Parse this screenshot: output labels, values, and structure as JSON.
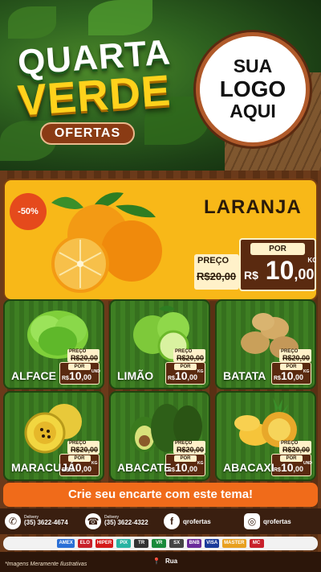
{
  "header": {
    "title_line1": "QUARTA",
    "title_line2": "VERDE",
    "subtitle_badge": "OFERTAS",
    "logo_placeholder": [
      "SUA",
      "LOGO",
      "AQUI"
    ]
  },
  "featured": {
    "name": "LARANJA",
    "discount_badge": "-50%",
    "old_price_label": "PREÇO",
    "old_price": "R$20,00",
    "new_price_label": "POR",
    "currency": "R$",
    "price_int": "10",
    "price_cents": ",00",
    "unit": "KG"
  },
  "products": [
    {
      "name": "ALFACE",
      "old_label": "PREÇO",
      "old_price": "R$20,00",
      "new_label": "POR",
      "currency": "R$",
      "price_int": "10",
      "price_cents": ",00",
      "unit": "UND"
    },
    {
      "name": "LIMÃO",
      "old_label": "PREÇO",
      "old_price": "R$20,00",
      "new_label": "POR",
      "currency": "R$",
      "price_int": "10",
      "price_cents": ",00",
      "unit": "KG"
    },
    {
      "name": "BATATA",
      "old_label": "PREÇO",
      "old_price": "R$20,00",
      "new_label": "POR",
      "currency": "R$",
      "price_int": "10",
      "price_cents": ",00",
      "unit": "KG"
    },
    {
      "name": "MARACUJÁ",
      "old_label": "PREÇO",
      "old_price": "R$20,00",
      "new_label": "POR",
      "currency": "R$",
      "price_int": "10",
      "price_cents": ",00",
      "unit": "KG"
    },
    {
      "name": "ABACATE",
      "old_label": "PREÇO",
      "old_price": "R$20,00",
      "new_label": "POR",
      "currency": "R$",
      "price_int": "10",
      "price_cents": ",00",
      "unit": "KG"
    },
    {
      "name": "ABACAXI",
      "old_label": "PREÇO",
      "old_price": "R$20,00",
      "new_label": "POR",
      "currency": "R$",
      "price_int": "10",
      "price_cents": ",00",
      "unit": "UND"
    }
  ],
  "cta": {
    "label": "Crie seu encarte com este tema!"
  },
  "contact": {
    "whatsapp": {
      "label": "Delivery",
      "number": "(35) 3622-4674",
      "icon": "whatsapp-icon"
    },
    "phone": {
      "label": "Delivery",
      "number": "(35) 3622-4322",
      "icon": "phone-icon"
    },
    "facebook": {
      "handle": "qrofertas",
      "icon": "facebook-icon"
    },
    "instagram": {
      "handle": "qrofertas",
      "icon": "instagram-icon"
    }
  },
  "payments": [
    "AMEX",
    "ELO",
    "HIPER",
    "PIX",
    "TR",
    "VR",
    "SX",
    "BNB",
    "VISA",
    "MASTER",
    "MC"
  ],
  "footer": {
    "disclaimer": "*Imagens Meramente Ilustrativas",
    "address": "Rua"
  },
  "colors": {
    "accent_yellow": "#ffd21c",
    "featured_bg": "#f8b818",
    "price_box": "#5a2a10",
    "cta": "#f06b1a",
    "card_green": "#3e7f23"
  }
}
